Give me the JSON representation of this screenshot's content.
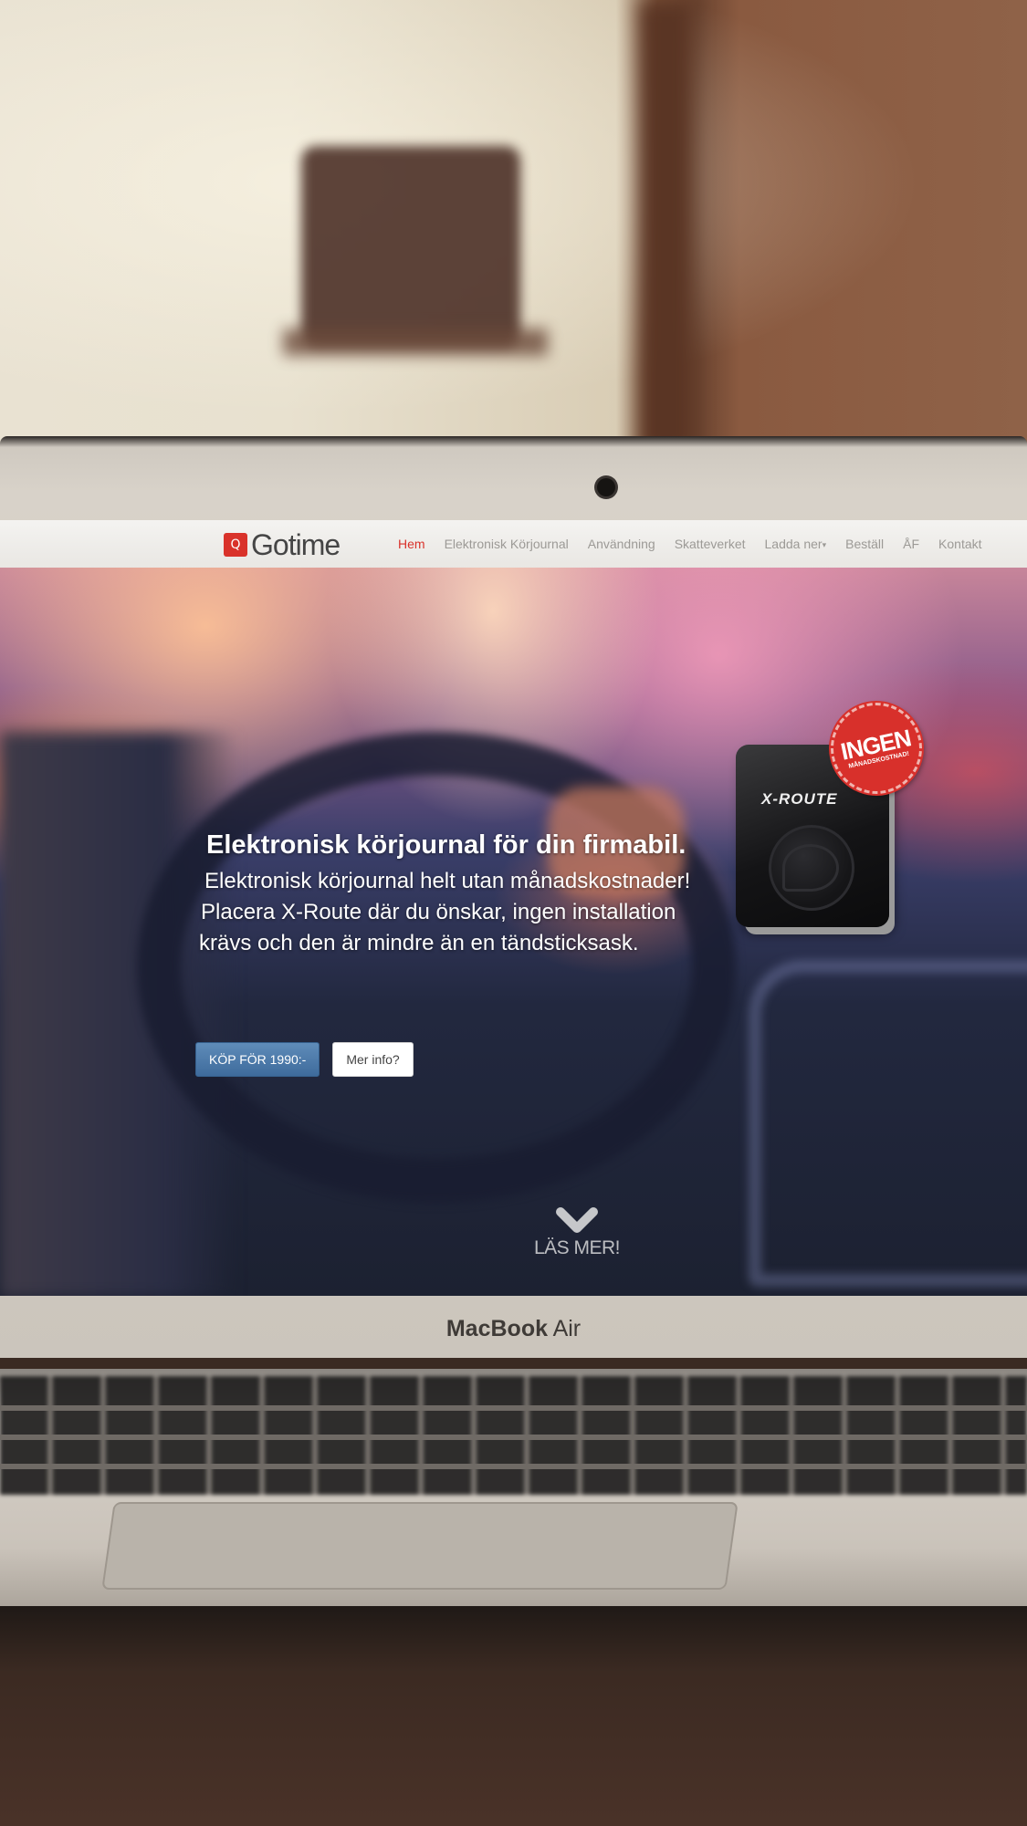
{
  "nav": {
    "logo_text": "Gotime",
    "logo_mark": "Q",
    "items": [
      {
        "label": "Hem",
        "active": true
      },
      {
        "label": "Elektronisk Körjournal",
        "active": false
      },
      {
        "label": "Användning",
        "active": false
      },
      {
        "label": "Skatteverket",
        "active": false
      },
      {
        "label": "Ladda ner",
        "active": false,
        "has_dropdown": true
      },
      {
        "label": "Beställ",
        "active": false
      },
      {
        "label": "ÅF",
        "active": false
      },
      {
        "label": "Kontakt",
        "active": false
      }
    ]
  },
  "hero": {
    "title": "Elektronisk körjournal för din firmabil.",
    "subtitle_lines": [
      "Elektronisk körjournal helt utan månadskostnader!",
      "Placera X-Route där du önskar, ingen installation",
      "krävs och den är mindre än en tändsticksask."
    ],
    "buy_button": "KÖP FÖR 1990:-",
    "info_button": "Mer info?",
    "product_brand": "X-ROUTE",
    "badge_main": "INGEN",
    "badge_small": "MÅNADSKOSTNAD!",
    "read_more": "LÄS MER!"
  },
  "device": {
    "label_brand": "MacBook",
    "label_model": "Air"
  },
  "colors": {
    "accent": "#d9322a",
    "buy_button": "#4a76a6"
  },
  "icons": {
    "chevron": "chevron-down-icon"
  }
}
